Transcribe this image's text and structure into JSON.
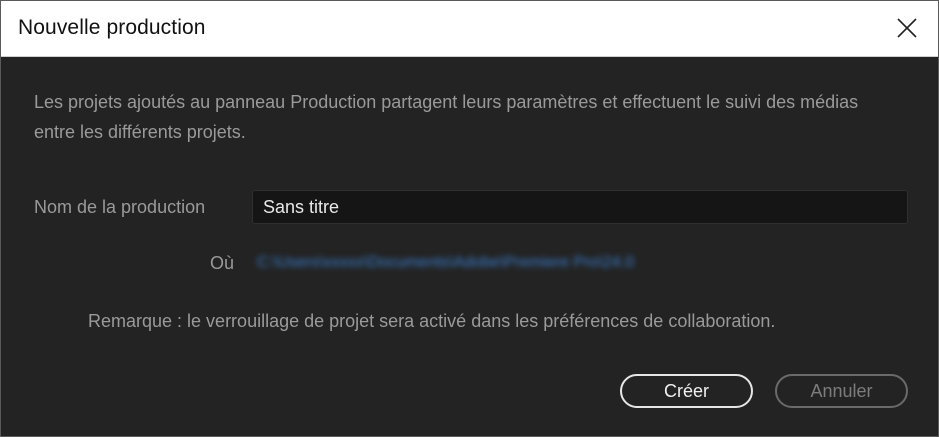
{
  "window": {
    "title": "Nouvelle production"
  },
  "close_icon": "close-icon",
  "dialog": {
    "description": "Les projets ajoutés au panneau Production partagent leurs paramètres et effectuent le suivi des médias entre les différents projets.",
    "name_label": "Nom de la production",
    "name_value": "Sans titre",
    "where_label": "Où",
    "location_path": "C:\\Users\\xxxxx\\Documents\\Adobe\\Premiere Pro\\24.0",
    "note": "Remarque : le verrouillage de projet sera activé dans les préférences de collaboration."
  },
  "buttons": {
    "create_label": "Créer",
    "cancel_label": "Annuler"
  },
  "colors": {
    "background": "#232323",
    "titlebar": "#ffffff",
    "link": "#3a7fd0",
    "text_muted": "#9a9a9a"
  }
}
